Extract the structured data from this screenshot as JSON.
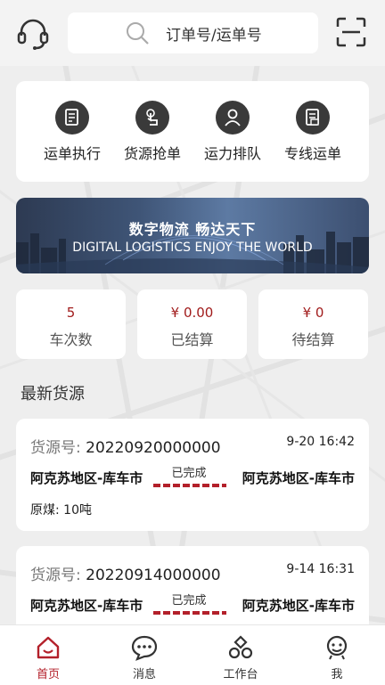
{
  "header": {
    "search_placeholder": "订单号/运单号"
  },
  "menu": [
    {
      "label": "运单执行",
      "icon": "document-edit-icon"
    },
    {
      "label": "货源抢单",
      "icon": "hand-tap-icon"
    },
    {
      "label": "运力排队",
      "icon": "people-queue-icon"
    },
    {
      "label": "专线运单",
      "icon": "document-list-icon"
    }
  ],
  "banner": {
    "title": "数字物流  畅达天下",
    "subtitle": "DIGITAL LOGISTICS  ENJOY THE WORLD"
  },
  "stats": [
    {
      "value": "5",
      "label": "车次数"
    },
    {
      "value": "¥ 0.00",
      "label": "已结算"
    },
    {
      "value": "¥ 0",
      "label": "待结算"
    }
  ],
  "section": {
    "title": "最新货源"
  },
  "cards": [
    {
      "no_label": "货源号:",
      "no": "20220920000000",
      "time": "9-20 16:42",
      "from": "阿克苏地区-库车市",
      "to": "阿克苏地区-库车市",
      "status": "已完成",
      "goods": "原煤:  10吨"
    },
    {
      "no_label": "货源号:",
      "no": "20220914000000",
      "time": "9-14 16:31",
      "from": "阿克苏地区-库车市",
      "to": "阿克苏地区-库车市",
      "status": "已完成"
    }
  ],
  "tabs": [
    {
      "label": "首页",
      "icon": "home-icon",
      "active": true
    },
    {
      "label": "消息",
      "icon": "message-icon"
    },
    {
      "label": "工作台",
      "icon": "workbench-icon"
    },
    {
      "label": "我",
      "icon": "profile-icon"
    }
  ],
  "colors": {
    "accent": "#b3202a",
    "background": "#eeeeee"
  }
}
